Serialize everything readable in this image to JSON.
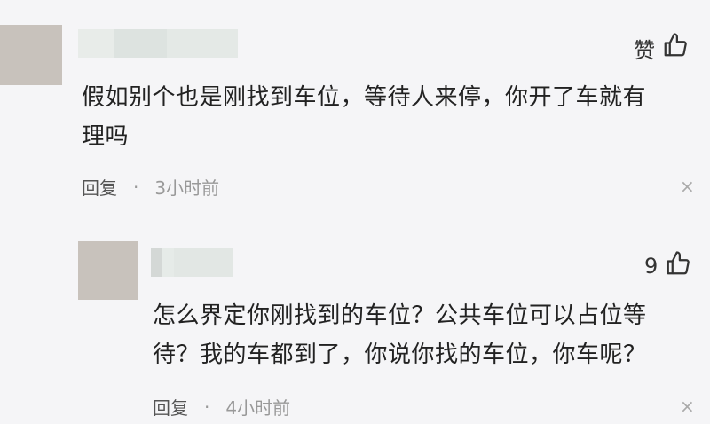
{
  "comments": [
    {
      "like_label": "赞",
      "text": "假如别个也是刚找到车位，等待人来停，你开了车就有理吗",
      "reply_label": "回复",
      "separator": "·",
      "time": "3小时前",
      "close_glyph": "×"
    },
    {
      "like_count": "9",
      "text": "怎么界定你刚找到的车位？公共车位可以占位等待？我的车都到了，你说你找的车位，你车呢？",
      "reply_label": "回复",
      "separator": "·",
      "time": "4小时前",
      "close_glyph": "×"
    }
  ],
  "icons": {
    "like": "thumbs-up-icon",
    "close": "close-icon"
  },
  "colors": {
    "background": "#f5f5f7",
    "avatar": "#c8c2bc",
    "meta_text": "#999999"
  }
}
